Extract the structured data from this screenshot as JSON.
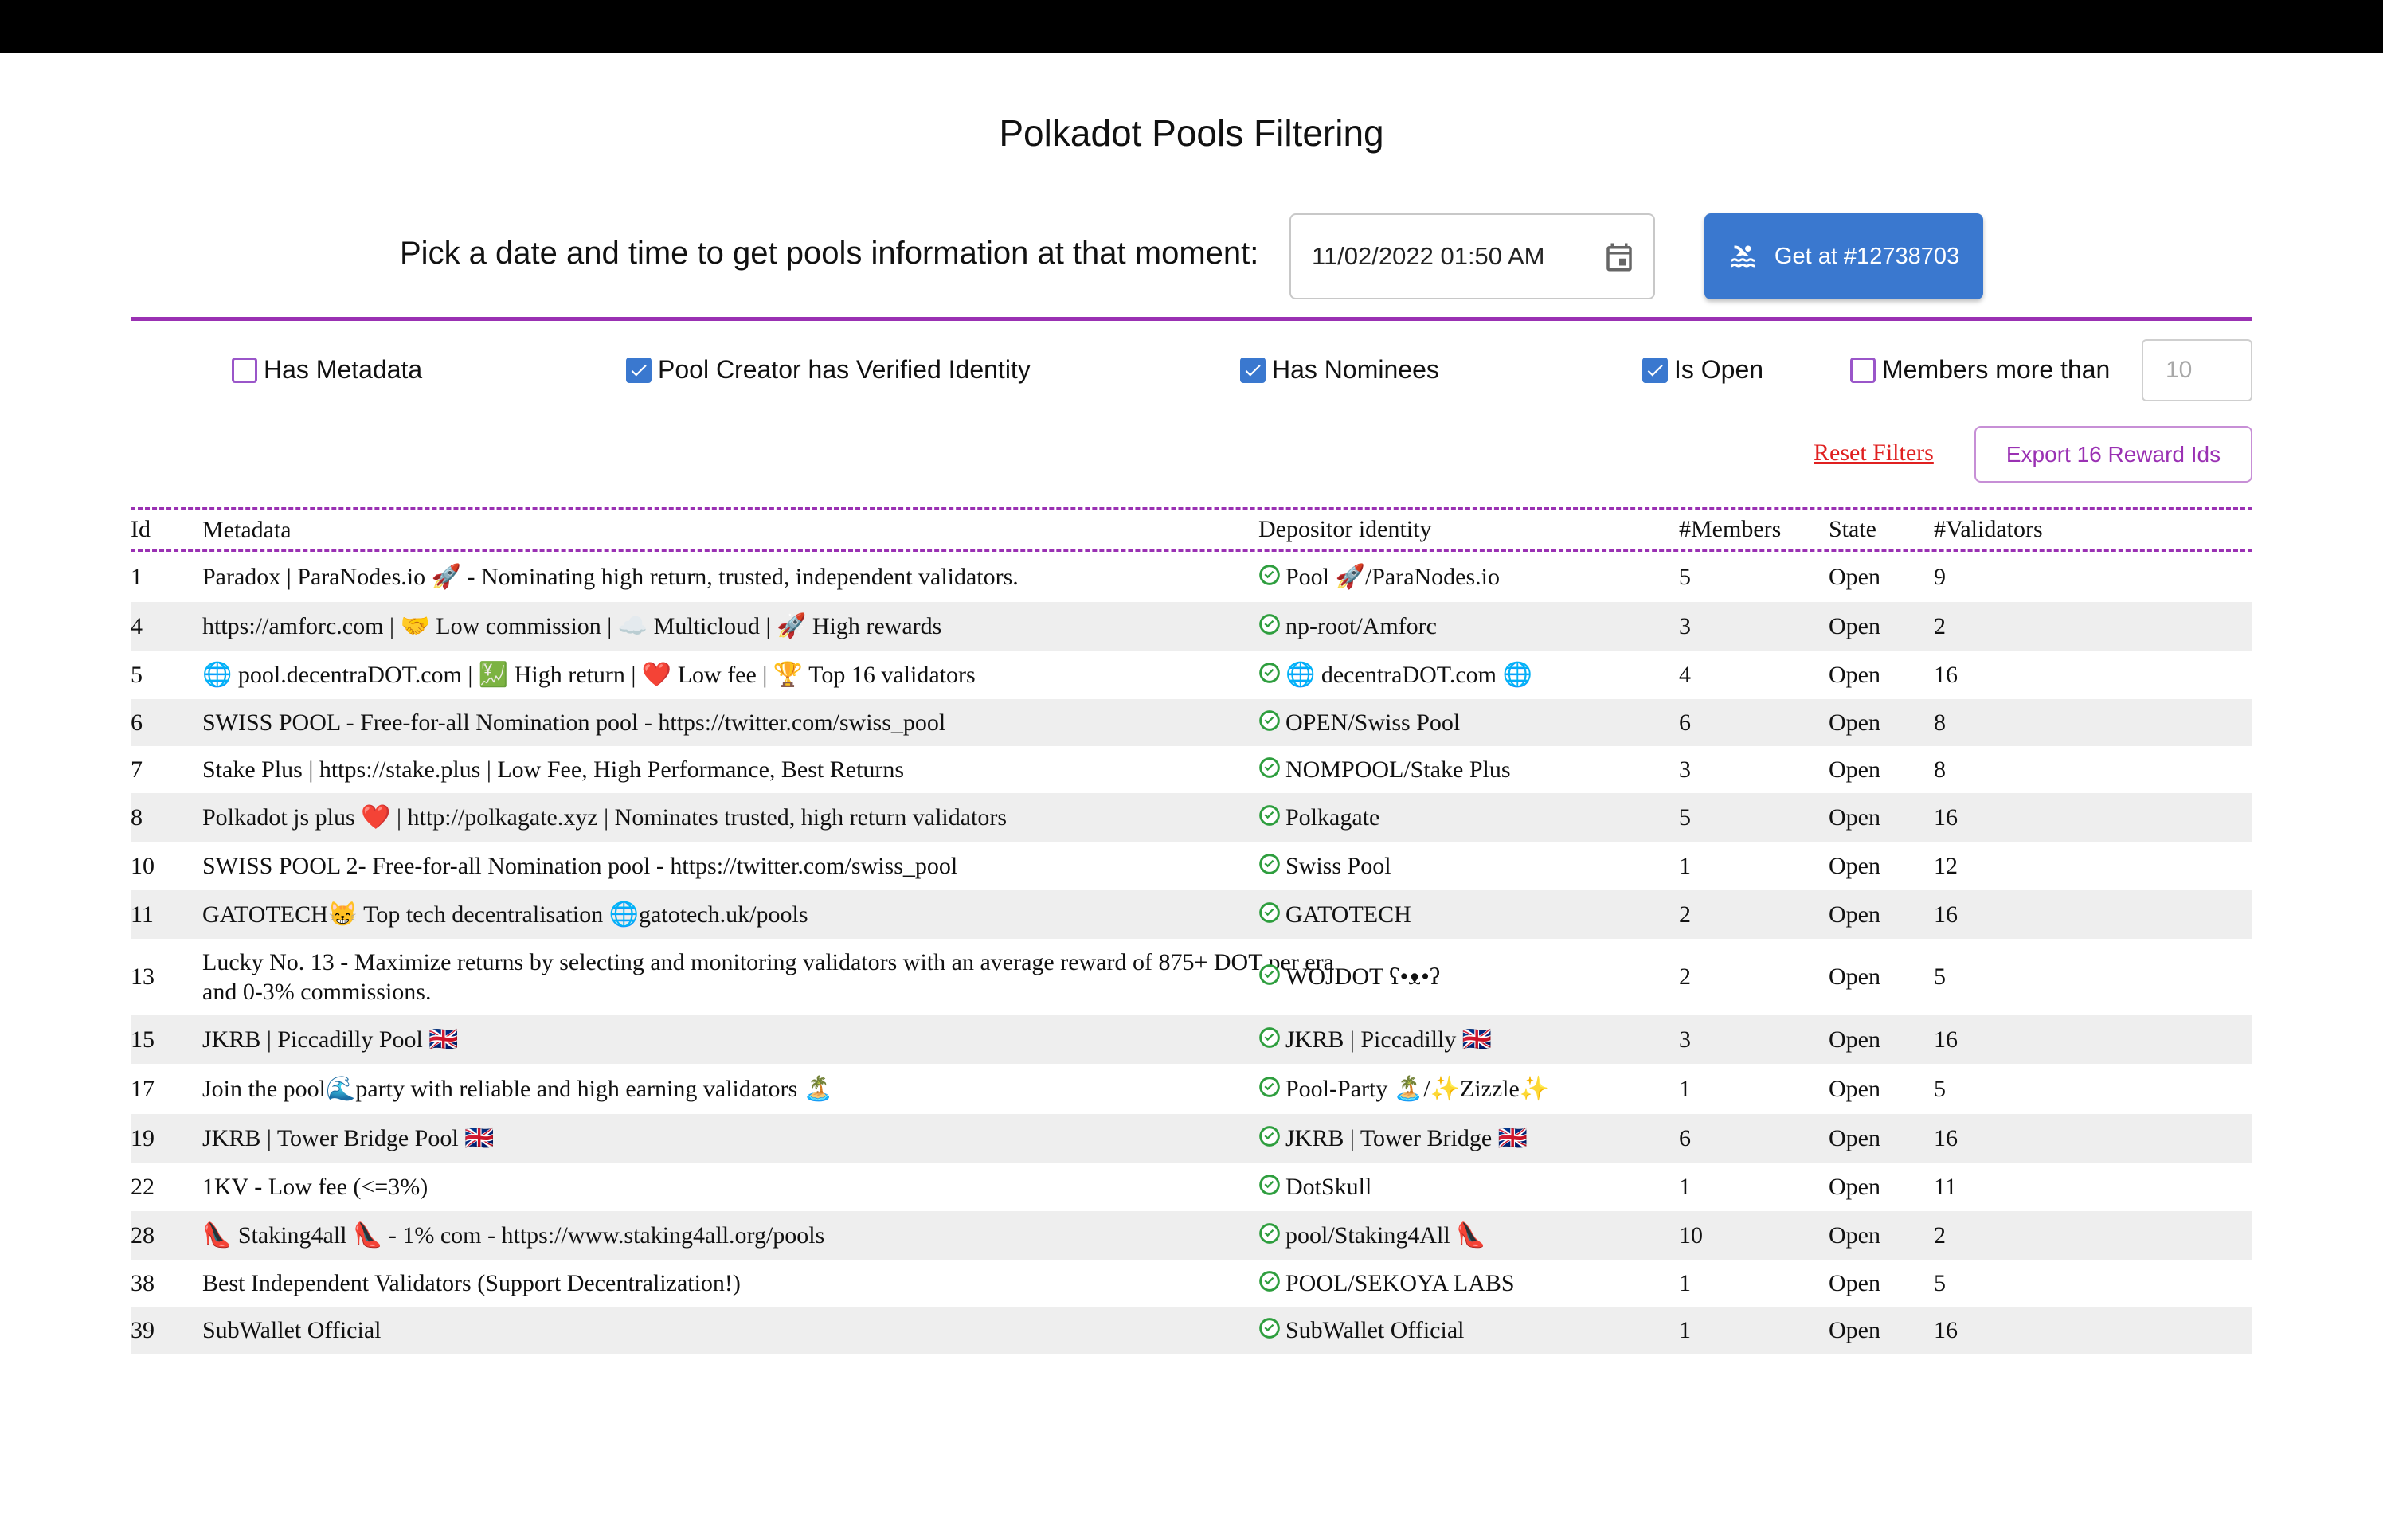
{
  "page": {
    "title": "Polkadot Pools Filtering",
    "picker_label": "Pick a date and time to get pools information at that moment:",
    "date_value": "11/02/2022 01:50 AM",
    "get_button_label": "Get at #12738703"
  },
  "filters": {
    "has_metadata": {
      "label": "Has Metadata",
      "checked": false
    },
    "verified_identity": {
      "label": "Pool Creator has Verified Identity",
      "checked": true
    },
    "has_nominees": {
      "label": "Has Nominees",
      "checked": true
    },
    "is_open": {
      "label": "Is Open",
      "checked": true
    },
    "members_more_than": {
      "label": "Members more than",
      "checked": false,
      "placeholder": "10"
    }
  },
  "actions": {
    "reset_label": "Reset Filters",
    "export_label": "Export 16 Reward Ids"
  },
  "table": {
    "headers": [
      "Id",
      "Metadata",
      "Depositor identity",
      "#Members",
      "State",
      "#Validators"
    ],
    "rows": [
      {
        "id": "1",
        "metadata": "Paradox | ParaNodes.io 🚀 - Nominating high return, trusted, independent validators.",
        "depositor": "Pool 🚀/ParaNodes.io",
        "members": "5",
        "state": "Open",
        "validators": "9"
      },
      {
        "id": "4",
        "metadata": "https://amforc.com | 🤝 Low commission | ☁️ Multicloud | 🚀 High rewards",
        "depositor": "np-root/Amforc",
        "members": "3",
        "state": "Open",
        "validators": "2"
      },
      {
        "id": "5",
        "metadata": "🌐 pool.decentraDOT.com | 💹 High return | ❤️ Low fee | 🏆 Top 16 validators",
        "depositor": "🌐 decentraDOT.com 🌐",
        "members": "4",
        "state": "Open",
        "validators": "16"
      },
      {
        "id": "6",
        "metadata": "SWISS POOL - Free-for-all Nomination pool - https://twitter.com/swiss_pool",
        "depositor": "OPEN/Swiss Pool",
        "members": "6",
        "state": "Open",
        "validators": "8"
      },
      {
        "id": "7",
        "metadata": "Stake Plus | https://stake.plus | Low Fee, High Performance, Best Returns",
        "depositor": "NOMPOOL/Stake Plus",
        "members": "3",
        "state": "Open",
        "validators": "8"
      },
      {
        "id": "8",
        "metadata": "Polkadot js plus ❤️ | http://polkagate.xyz | Nominates trusted, high return validators",
        "depositor": "Polkagate",
        "members": "5",
        "state": "Open",
        "validators": "16"
      },
      {
        "id": "10",
        "metadata": "SWISS POOL 2- Free-for-all Nomination pool - https://twitter.com/swiss_pool",
        "depositor": "Swiss Pool",
        "members": "1",
        "state": "Open",
        "validators": "12"
      },
      {
        "id": "11",
        "metadata": "GATOTECH😸 Top tech decentralisation 🌐gatotech.uk/pools",
        "depositor": "GATOTECH",
        "members": "2",
        "state": "Open",
        "validators": "16"
      },
      {
        "id": "13",
        "metadata": "Lucky No. 13 - Maximize returns by selecting and monitoring validators with an average reward of 875+ DOT per era and 0-3% commissions.",
        "depositor": "WOJDOT ʕ•ᴥ•ʔ",
        "members": "2",
        "state": "Open",
        "validators": "5"
      },
      {
        "id": "15",
        "metadata": "JKRB | Piccadilly Pool 🇬🇧",
        "depositor": "JKRB | Piccadilly 🇬🇧",
        "members": "3",
        "state": "Open",
        "validators": "16"
      },
      {
        "id": "17",
        "metadata": "Join the pool🌊party with reliable and high earning validators 🏝️",
        "depositor": "Pool-Party 🏝️/✨Zizzle✨",
        "members": "1",
        "state": "Open",
        "validators": "5"
      },
      {
        "id": "19",
        "metadata": "JKRB | Tower Bridge Pool 🇬🇧",
        "depositor": "JKRB | Tower Bridge 🇬🇧",
        "members": "6",
        "state": "Open",
        "validators": "16"
      },
      {
        "id": "22",
        "metadata": "1KV - Low fee (<=3%)",
        "depositor": "DotSkull",
        "members": "1",
        "state": "Open",
        "validators": "11"
      },
      {
        "id": "28",
        "metadata": "👠 Staking4all 👠 - 1% com - https://www.staking4all.org/pools",
        "depositor": "pool/Staking4All 👠",
        "members": "10",
        "state": "Open",
        "validators": "2"
      },
      {
        "id": "38",
        "metadata": "Best Independent Validators (Support Decentralization!)",
        "depositor": "POOL/SEKOYA LABS",
        "members": "1",
        "state": "Open",
        "validators": "5"
      },
      {
        "id": "39",
        "metadata": "SubWallet Official",
        "depositor": "SubWallet Official",
        "members": "1",
        "state": "Open",
        "validators": "16"
      }
    ]
  },
  "colors": {
    "accent_purple": "#9a31b3",
    "button_blue": "#3a78cf",
    "reset_red": "#e02020",
    "verified_green": "#2e9e3e",
    "row_alt": "#eeeeee"
  },
  "icons": {
    "date_picker": "calendar-icon",
    "get_button": "pool-swim-icon",
    "verified": "verified-check-icon"
  }
}
